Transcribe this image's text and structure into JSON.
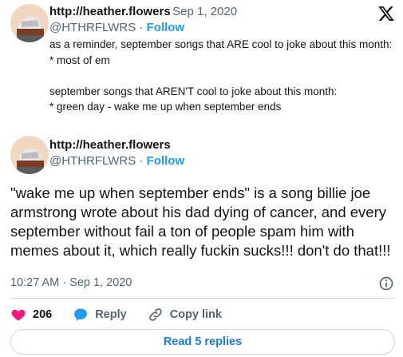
{
  "quoted_tweet": {
    "name": "http://heather.flowers",
    "date": "Sep 1, 2020",
    "handle": "@HTHRFLWRS",
    "follow_label": "Follow",
    "text": "as a reminder, september songs that ARE cool to joke about this month:\n* most of em\n\nseptember songs that AREN'T cool to joke about this month:\n* green day - wake me up when september ends"
  },
  "tweet": {
    "name": "http://heather.flowers",
    "handle": "@HTHRFLWRS",
    "follow_label": "Follow",
    "text": "\"wake me up when september ends\" is a song billie joe armstrong wrote about his dad dying of cancer, and every september without fail a ton of people spam him with memes about it, which really fuckin sucks!!! don't do that!!!",
    "time": "10:27 AM",
    "date": "Sep 1, 2020"
  },
  "actions": {
    "likes": "206",
    "reply_label": "Reply",
    "copy_link_label": "Copy link"
  },
  "read_replies_label": "Read 5 replies",
  "colors": {
    "accent": "#1d9bf0",
    "heart": "#f91880",
    "muted": "#536471",
    "divider": "#cfd9de"
  },
  "icons": [
    "x-logo-icon",
    "info-icon",
    "heart-icon",
    "reply-icon",
    "link-icon"
  ]
}
